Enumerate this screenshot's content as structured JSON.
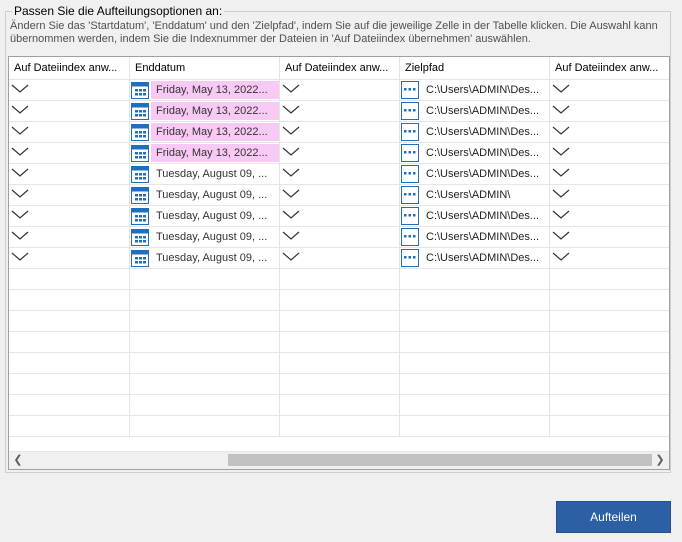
{
  "group": {
    "title": "Passen Sie die Aufteilungsoptionen an:",
    "description": "Ändern Sie das 'Startdatum', 'Enddatum' und den 'Zielpfad', indem Sie auf die jeweilige Zelle in der Tabelle klicken. Die Auswahl kann übernommen werden, indem Sie die Indexnummer der Dateien in 'Auf Dateiindex übernehmen' auswählen."
  },
  "grid": {
    "columns": [
      "Auf Dateiindex anw...",
      "Enddatum",
      "Auf Dateiindex anw...",
      "Zielpfad",
      "Auf Dateiindex anw..."
    ],
    "rows": [
      {
        "enddatum": "Friday, May 13, 2022...",
        "selected": true,
        "zielpfad": "C:\\Users\\ADMIN\\Des..."
      },
      {
        "enddatum": "Friday, May 13, 2022...",
        "selected": true,
        "zielpfad": "C:\\Users\\ADMIN\\Des..."
      },
      {
        "enddatum": "Friday, May 13, 2022...",
        "selected": true,
        "zielpfad": "C:\\Users\\ADMIN\\Des..."
      },
      {
        "enddatum": "Friday, May 13, 2022...",
        "selected": true,
        "zielpfad": "C:\\Users\\ADMIN\\Des..."
      },
      {
        "enddatum": "Tuesday, August 09, ...",
        "selected": false,
        "zielpfad": "C:\\Users\\ADMIN\\Des..."
      },
      {
        "enddatum": "Tuesday, August 09, ...",
        "selected": false,
        "zielpfad": "C:\\Users\\ADMIN\\"
      },
      {
        "enddatum": "Tuesday, August 09, ...",
        "selected": false,
        "zielpfad": "C:\\Users\\ADMIN\\Des..."
      },
      {
        "enddatum": "Tuesday, August 09, ...",
        "selected": false,
        "zielpfad": "C:\\Users\\ADMIN\\Des..."
      },
      {
        "enddatum": "Tuesday, August 09, ...",
        "selected": false,
        "zielpfad": "C:\\Users\\ADMIN\\Des..."
      }
    ],
    "empty_rows": 8
  },
  "scroll": {
    "left_icon": "scroll-left-arrow",
    "right_icon": "scroll-right-arrow"
  },
  "button": {
    "label": "Aufteilen"
  },
  "colors": {
    "accent": "#2d5fa4",
    "selection": "#f9c9f5",
    "background": "#f0f0f0"
  }
}
